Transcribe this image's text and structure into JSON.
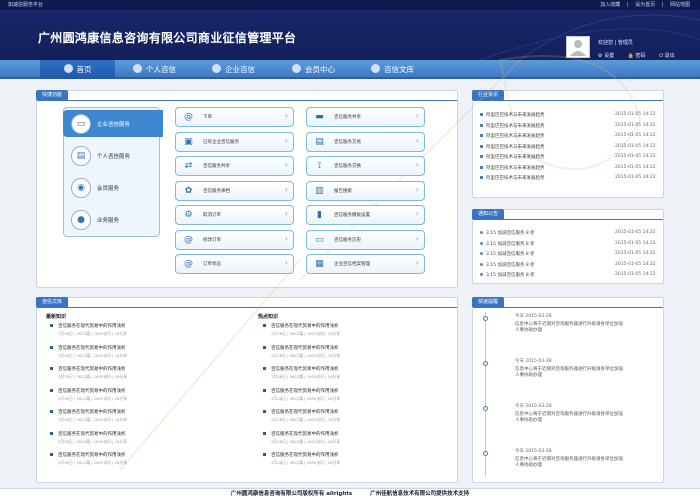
{
  "topbar": {
    "site": "如诚信服务平台",
    "links": [
      "加入收藏",
      "|",
      "设为首页",
      "|",
      "网站地图"
    ]
  },
  "header": {
    "title": "广州圆鸿康信息咨询有限公司商业征信管理平台",
    "welcome": "欢迎您 | 管理员",
    "ops": [
      "设置",
      "密码",
      "退出"
    ]
  },
  "nav": [
    {
      "label": "首页",
      "active": true
    },
    {
      "label": "个人咨信"
    },
    {
      "label": "企业咨信"
    },
    {
      "label": "会员中心"
    },
    {
      "label": "咨信文库"
    }
  ],
  "quick": {
    "title": "快捷功能",
    "categories": [
      "企业咨信服务",
      "个人咨信服务",
      "会员服务",
      "业务服务"
    ],
    "col1": [
      "下单",
      "已有企业咨信服务",
      "咨信服务共享",
      "咨信服务律档",
      "取消订单",
      "修改订单",
      "订单状态"
    ],
    "col2": [
      "咨信服务共享",
      "咨信服务交易",
      "咨信服务交换",
      "报告搜索",
      "咨信服务模板设置",
      "咨信服务历史",
      "企业咨信档案管理"
    ]
  },
  "industry": {
    "title": "行业资讯",
    "items": [
      {
        "t": "阿里巴巴技术与未来发展趋势",
        "d": "2015-01-05  14:22"
      },
      {
        "t": "阿里巴巴技术与未来发展趋势",
        "d": "2015-01-05  14:22"
      },
      {
        "t": "阿里巴巴技术与未来发展趋势",
        "d": "2015-01-05  14:22"
      },
      {
        "t": "阿里巴巴技术与未来发展趋势",
        "d": "2015-01-05  14:22"
      },
      {
        "t": "阿里巴巴技术与未来发展趋势",
        "d": "2015-01-05  14:22"
      },
      {
        "t": "阿里巴巴技术与未来发展趋势",
        "d": "2015-01-05  14:22"
      },
      {
        "t": "阿里巴巴技术与未来发展趋势",
        "d": "2015-01-05  14:22"
      }
    ]
  },
  "notice": {
    "title": "通知公告",
    "items": [
      {
        "t": "3.15 加减咨信服务 8 折",
        "d": "2015-01-05  14:22"
      },
      {
        "t": "3.15 加减咨信服务 8 折",
        "d": "2015-01-05  14:22"
      },
      {
        "t": "3.15 加减咨信服务 8 折",
        "d": "2015-01-05  14:22"
      },
      {
        "t": "3.15 加减咨信服务 8 折",
        "d": "2015-01-05  14:22"
      },
      {
        "t": "3.15 加减咨信服务 8 折",
        "d": "2015-01-05  14:22"
      }
    ]
  },
  "library": {
    "title": "咨信文库",
    "latest": "最新知识",
    "hot": "热点知识",
    "article": {
      "t": "咨信服务在现代贸易中的作用浅析",
      "m": "3月28日 | 3622篇 | 1605访问 | 18分享"
    },
    "count": 7
  },
  "timeline": {
    "title": "快速提醒",
    "items": [
      {
        "time": "今天   2015-03-28",
        "text": "信息中心将于近期对咨询服务器进行升级请各单位加强人事协助办理"
      },
      {
        "time": "今天   2015-03-28",
        "text": "信息中心将于近期对咨询服务器进行升级请各单位加强人事协助办理"
      },
      {
        "time": "今天   2015-03-28",
        "text": "信息中心将于近期对咨询服务器进行升级请各单位加强人事协助办理"
      },
      {
        "time": "今天   2015-03-28",
        "text": "信息中心将于近期对咨询服务器进行升级请各单位加强人事协助办理"
      }
    ]
  },
  "footer": {
    "left": "广州圆鸿康信息咨询有限公司版权所有 allrights",
    "right": "广州佳航信息技术有限公司提供技术支持"
  }
}
